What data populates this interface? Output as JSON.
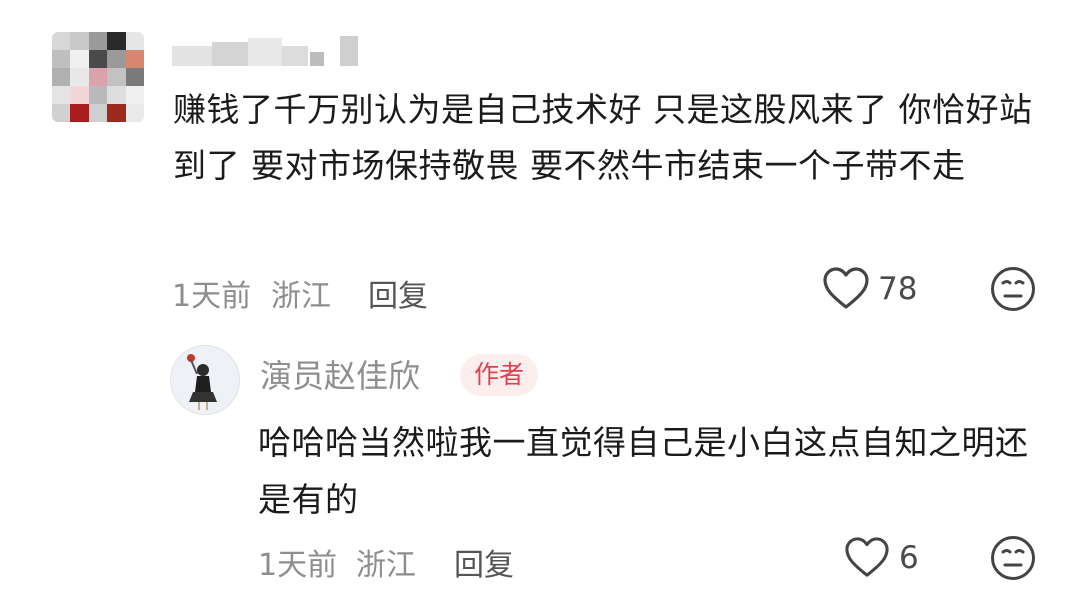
{
  "comment": {
    "avatar_icon": "pixelated-avatar-icon",
    "username_icon": "blurred-username-icon",
    "text": "赚钱了千万别认为是自己技术好 只是这股风来了 你恰好站到了 要对市场保持敬畏 要不然牛市结束一个子带不走",
    "time": "1天前",
    "location": "浙江",
    "reply_label": "回复",
    "likes": "78",
    "like_icon": "heart-outline-icon",
    "react_icon": "neutral-face-icon"
  },
  "reply": {
    "avatar_icon": "user-photo-avatar-icon",
    "username": "演员赵佳欣",
    "badge": "作者",
    "badge_color": "#e0404f",
    "text": "哈哈哈当然啦我一直觉得自己是小白这点自知之明还是有的",
    "time": "1天前",
    "location": "浙江",
    "reply_label": "回复",
    "likes": "6",
    "like_icon": "heart-outline-icon",
    "react_icon": "neutral-face-icon"
  }
}
